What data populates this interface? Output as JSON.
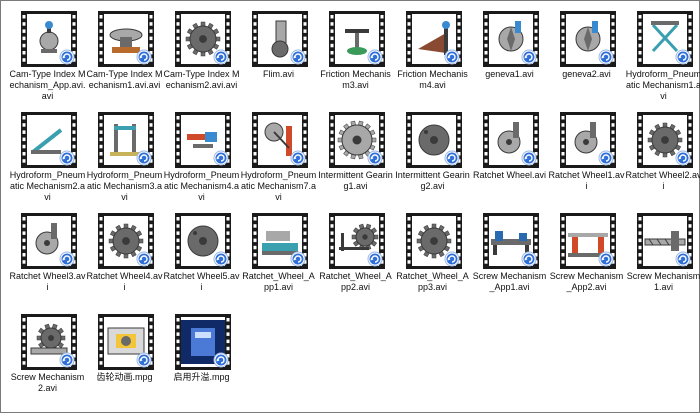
{
  "files": [
    {
      "name": "Cam-Type Index Mechanism_App.avi.avi",
      "kind": "video",
      "icon": "cam-index-app-icon",
      "art": "cam"
    },
    {
      "name": "Cam-Type Index Mechanism1.avi.avi",
      "kind": "video",
      "icon": "cam-index-1-icon",
      "art": "camdisk"
    },
    {
      "name": "Cam-Type Index Mechanism2.avi.avi",
      "kind": "video",
      "icon": "cam-index-2-icon",
      "art": "gear"
    },
    {
      "name": "Flim.avi",
      "kind": "video",
      "icon": "film-mechanism-icon",
      "art": "flim"
    },
    {
      "name": "Friction Mechanism3.avi",
      "kind": "video",
      "icon": "friction-3-icon",
      "art": "friction"
    },
    {
      "name": "Friction Mechanism4.avi",
      "kind": "video",
      "icon": "friction-4-icon",
      "art": "cone"
    },
    {
      "name": "geneva1.avi",
      "kind": "video",
      "icon": "geneva-1-icon",
      "art": "geneva"
    },
    {
      "name": "geneva2.avi",
      "kind": "video",
      "icon": "geneva-2-icon",
      "art": "geneva"
    },
    {
      "name": "Hydroform_Pneumatic Mechanism1.avi",
      "kind": "video",
      "icon": "hydro-1-icon",
      "art": "scissor"
    },
    {
      "name": "Hydroform_Pneumatic Mechanism2.avi",
      "kind": "video",
      "icon": "hydro-2-icon",
      "art": "arm"
    },
    {
      "name": "Hydroform_Pneumatic Mechanism3.avi",
      "kind": "video",
      "icon": "hydro-3-icon",
      "art": "press"
    },
    {
      "name": "Hydroform_Pneumatic Mechanism4.avi",
      "kind": "video",
      "icon": "hydro-4-icon",
      "art": "piston"
    },
    {
      "name": "Hydroform_Pneumatic Mechanism7.avi",
      "kind": "video",
      "icon": "hydro-7-icon",
      "art": "wheelrod"
    },
    {
      "name": "Intermittent Gearing1.avi",
      "kind": "video",
      "icon": "intermittent-1-icon",
      "art": "biggear"
    },
    {
      "name": "Intermittent Gearing2.avi",
      "kind": "video",
      "icon": "intermittent-2-icon",
      "art": "disk"
    },
    {
      "name": "Ratchet Wheel.avi",
      "kind": "video",
      "icon": "ratchet-icon",
      "art": "ratchet"
    },
    {
      "name": "Ratchet Wheel1.avi",
      "kind": "video",
      "icon": "ratchet-1-icon",
      "art": "ratchet"
    },
    {
      "name": "Ratchet Wheel2.avi",
      "kind": "video",
      "icon": "ratchet-2-icon",
      "art": "gear"
    },
    {
      "name": "Ratchet Wheel3.avi",
      "kind": "video",
      "icon": "ratchet-3-icon",
      "art": "ratchet"
    },
    {
      "name": "Ratchet Wheel4.avi",
      "kind": "video",
      "icon": "ratchet-4-icon",
      "art": "gear"
    },
    {
      "name": "Ratchet Wheel5.avi",
      "kind": "video",
      "icon": "ratchet-5-icon",
      "art": "disk"
    },
    {
      "name": "Ratchet_Wheel_App1.avi",
      "kind": "video",
      "icon": "ratchet-app-1-icon",
      "art": "machine"
    },
    {
      "name": "Ratchet_Wheel_App2.avi",
      "kind": "video",
      "icon": "ratchet-app-2-icon",
      "art": "geartrain"
    },
    {
      "name": "Ratchet_Wheel_App3.avi",
      "kind": "video",
      "icon": "ratchet-app-3-icon",
      "art": "gear"
    },
    {
      "name": "Screw Mechanism_App1.avi",
      "kind": "video",
      "icon": "screw-app-1-icon",
      "art": "lathe"
    },
    {
      "name": "Screw Mechanism_App2.avi",
      "kind": "video",
      "icon": "screw-app-2-icon",
      "art": "vise"
    },
    {
      "name": "Screw Mechanism1.avi",
      "kind": "video",
      "icon": "screw-1-icon",
      "art": "screw"
    },
    {
      "name": "Screw Mechanism2.avi",
      "kind": "video",
      "icon": "screw-2-icon",
      "art": "worm"
    },
    {
      "name": "齿轮动画.mpg",
      "kind": "video",
      "icon": "gear-animation-icon",
      "art": "box"
    },
    {
      "name": "启用升溢.mpg",
      "kind": "video",
      "icon": "upgrade-icon",
      "art": "blue"
    }
  ],
  "colors": {
    "film": "#1a1a1a",
    "frame": "#ffffff",
    "badge": "#2f6fd8",
    "text": "#111111"
  }
}
